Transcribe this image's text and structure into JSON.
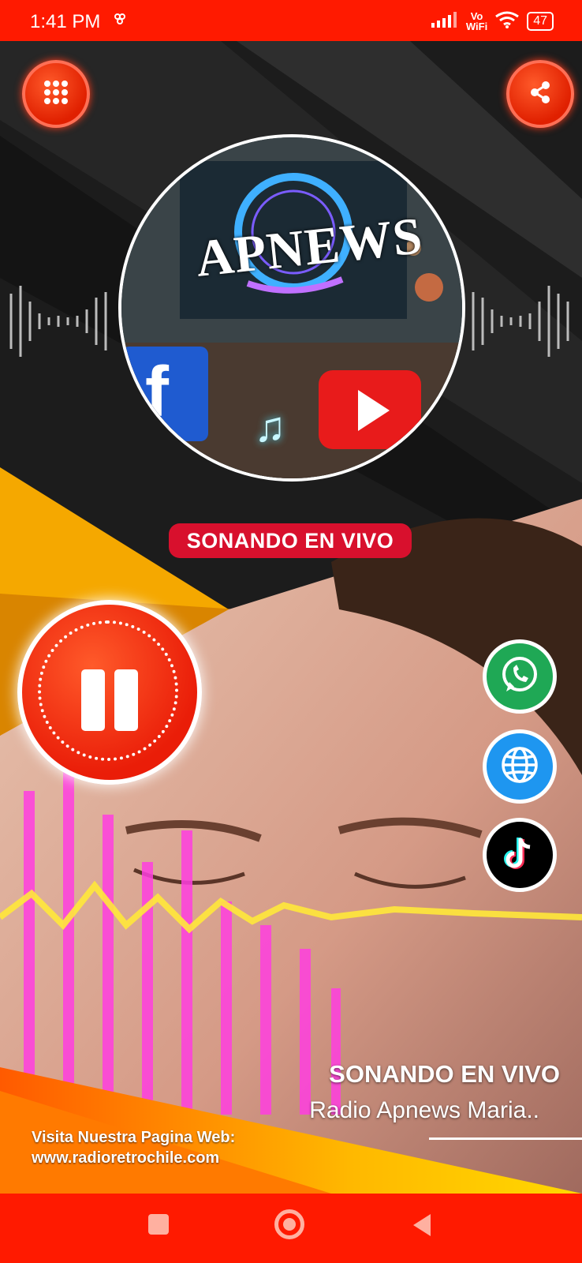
{
  "status_bar": {
    "time": "1:41 PM",
    "extra_icon": "flower-notification-icon",
    "vo_wifi_top": "Vo",
    "vo_wifi_bottom": "WiFi",
    "battery": "47"
  },
  "header": {
    "menu_icon": "grid-menu-icon",
    "share_icon": "share-icon"
  },
  "artwork": {
    "logo_text": "APNEWS"
  },
  "live_badge": "SONANDO EN VIVO",
  "player": {
    "state_icon": "pause-icon"
  },
  "social_buttons": [
    {
      "name": "whatsapp",
      "color": "#1fa855"
    },
    {
      "name": "website",
      "color": "#1e96f0"
    },
    {
      "name": "tiktok",
      "color": "#000000"
    }
  ],
  "now_playing": {
    "title": "SONANDO EN VIVO",
    "station": "Radio Apnews Maria.."
  },
  "footer": {
    "line1": "Visita Nuestra Pagina Web:",
    "line2": "www.radioretrochile.com"
  },
  "colors": {
    "accent": "#ff1a00",
    "badge": "#d8102d"
  }
}
